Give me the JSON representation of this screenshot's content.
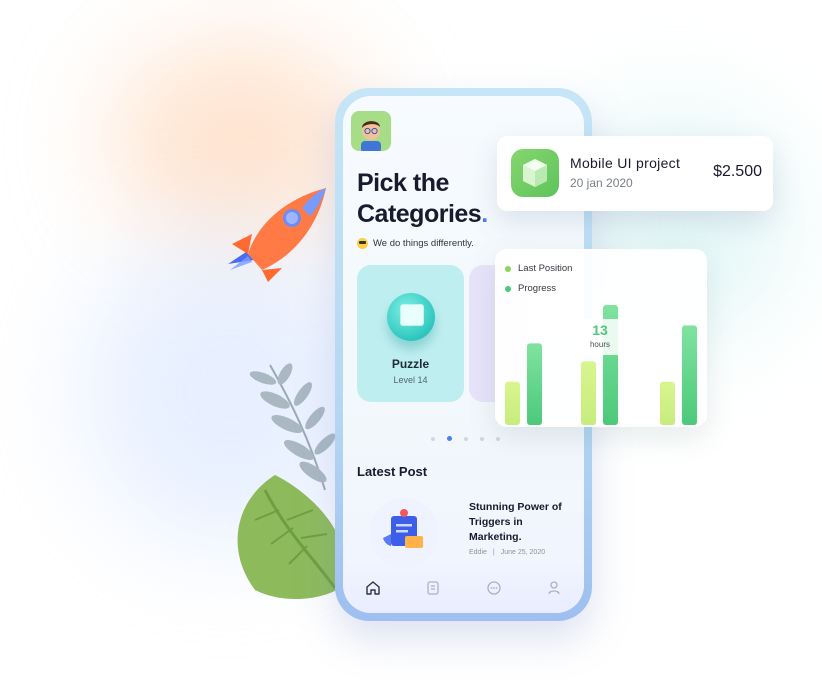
{
  "screen": {
    "title_line1": "Pick the",
    "title_line2": "Categories",
    "title_dot": ".",
    "tagline": "We do things differently.",
    "categories": [
      {
        "name": "Puzzle",
        "level": "Level 14"
      }
    ],
    "carousel_active_index": 1,
    "carousel_count": 5,
    "latest_heading": "Latest Post",
    "post": {
      "title": "Stunning Power of Triggers in Marketing.",
      "author": "Eddie",
      "separator": "|",
      "date": "June 25, 2020"
    },
    "nav": [
      "home-icon",
      "document-icon",
      "chat-icon",
      "profile-icon"
    ]
  },
  "project_card": {
    "title": "Mobile UI project",
    "date": "20 jan 2020",
    "price": "$2.500"
  },
  "chart_card": {
    "legend": [
      {
        "label": "Last Position",
        "color": "#8ad55a"
      },
      {
        "label": "Progress",
        "color": "#4cc97a"
      }
    ],
    "highlight_value": "13",
    "highlight_unit": "hours"
  },
  "chart_data": {
    "type": "bar",
    "series": [
      {
        "name": "Last Position",
        "values": [
          0.36,
          0.53,
          0.36
        ]
      },
      {
        "name": "Progress",
        "values": [
          0.68,
          1.0,
          0.83
        ]
      }
    ],
    "colors": {
      "Last Position": "#d9f58f",
      "Progress": "#4cc97a"
    },
    "highlight": {
      "group": 1,
      "value": "13",
      "unit": "hours"
    }
  },
  "colors": {
    "accent": "#4a7ef7",
    "green": "#4cc97a",
    "teal_card": "#bfeef0"
  }
}
